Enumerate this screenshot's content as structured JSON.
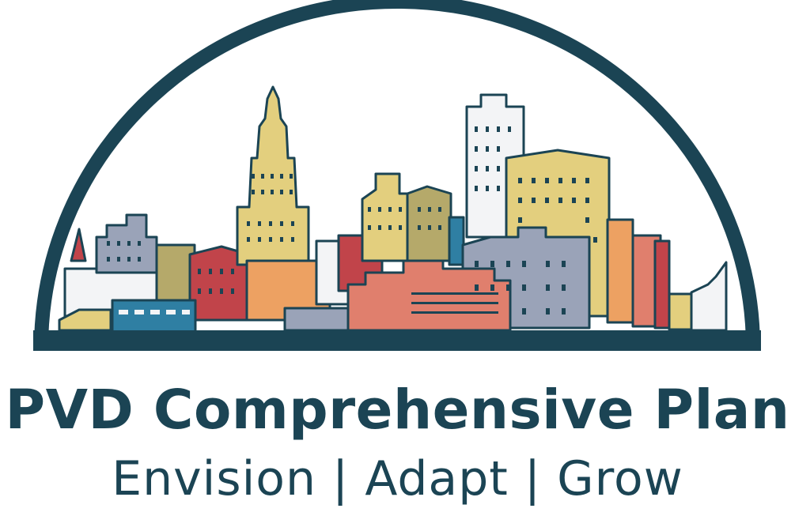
{
  "logo": {
    "title": "PVD Comprehensive Plan",
    "tagline": "Envision | Adapt | Grow"
  },
  "palette": {
    "arch": "#1b4454",
    "outline": "#1b4454",
    "yellow": "#e3cf7e",
    "olive": "#b5a96a",
    "gray_blue": "#9aa3b8",
    "red": "#c1444a",
    "salmon": "#e07f6d",
    "orange": "#eda162",
    "teal": "#2f7fa3",
    "white": "#f3f4f6"
  }
}
